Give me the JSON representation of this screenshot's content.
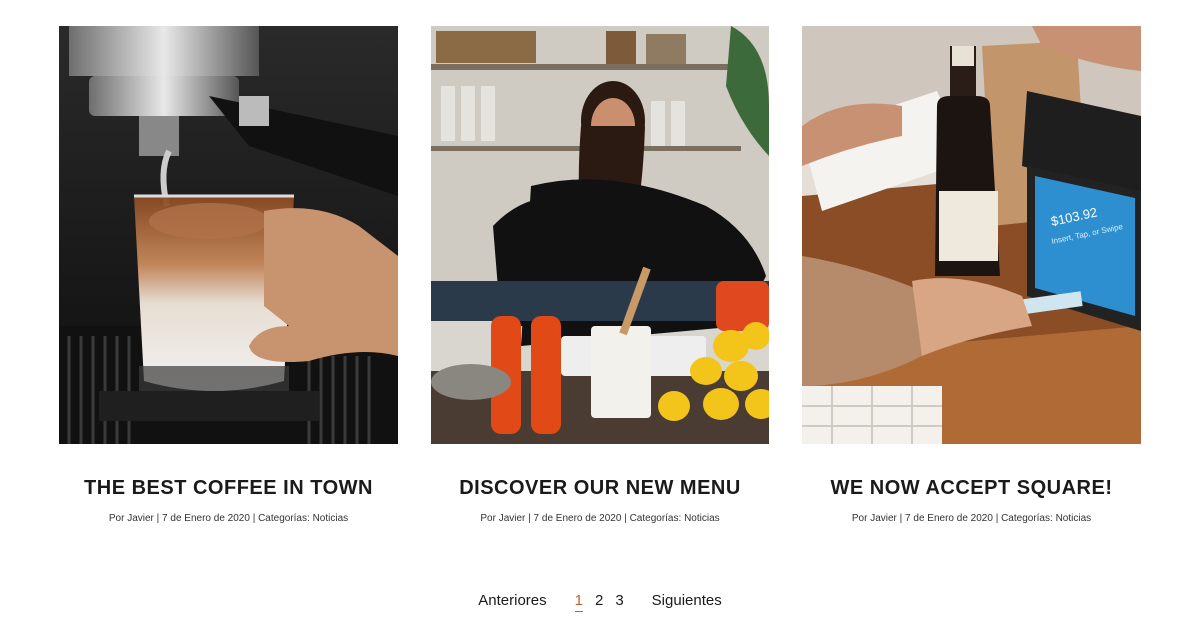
{
  "posts": [
    {
      "title": "THE BEST COFFEE IN TOWN",
      "meta_prefix": "Por",
      "author": "Javier",
      "date": "7 de Enero de 2020",
      "categories_label": "Categorías:",
      "category": "Noticias",
      "image_alt": "coffee-photo"
    },
    {
      "title": "DISCOVER OUR NEW MENU",
      "meta_prefix": "Por",
      "author": "Javier",
      "date": "7 de Enero de 2020",
      "categories_label": "Categorías:",
      "category": "Noticias",
      "image_alt": "kitchen-photo"
    },
    {
      "title": "WE NOW ACCEPT SQUARE!",
      "meta_prefix": "Por",
      "author": "Javier",
      "date": "7 de Enero de 2020",
      "categories_label": "Categorías:",
      "category": "Noticias",
      "image_alt": "payment-photo",
      "terminal_amount": "$103.92",
      "terminal_hint": "Insert, Tap, or Swipe"
    }
  ],
  "meta_separator": "|",
  "pagination": {
    "prev_label": "Anteriores",
    "pages": [
      "1",
      "2",
      "3"
    ],
    "current": "1",
    "next_label": "Siguientes"
  },
  "colors": {
    "accent": "#c0622f",
    "text": "#1a1a1a"
  }
}
